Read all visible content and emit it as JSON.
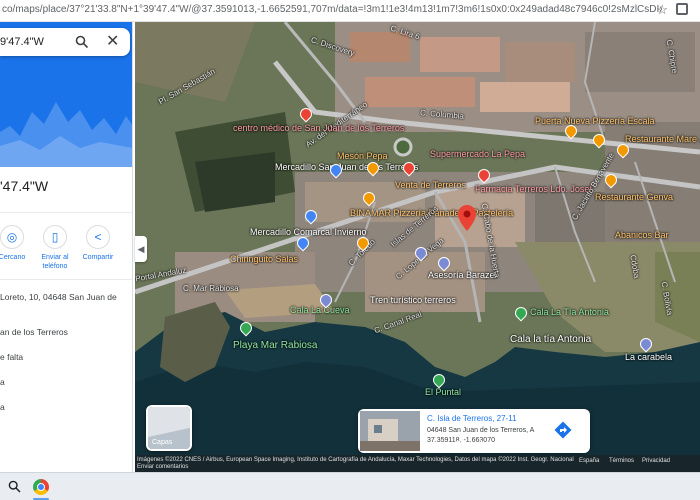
{
  "browser": {
    "url": "co/maps/place/37°21'33.8\"N+1°39'47.4\"W/@37.3591013,-1.6652591,707m/data=!3m1!1e3!4m13!1m7!3m6!1s0x0:0x249adad48c7946c0!2sMzlCsDIxJzMzLjgiTiAxwrAzOScNy40lc!3b1!8m2!3d37.359118!4d-1.6630"
  },
  "sidebar": {
    "search_value": "9'47.4\"W",
    "coordinate_title": "'47.4\"W",
    "actions": [
      {
        "label": "Cercano",
        "icon": "nearby-icon"
      },
      {
        "label": "Enviar al teléfono",
        "icon": "send-to-phone-icon"
      },
      {
        "label": "Compartir",
        "icon": "share-icon"
      }
    ],
    "info_lines": [
      "Loreto, 10, 04648 San Juan de",
      "an de los Terreros",
      "e falta",
      "a",
      "a"
    ]
  },
  "map": {
    "labels": [
      {
        "text": "C. Discovery",
        "kind": "street"
      },
      {
        "text": "C. Lira 6",
        "kind": "street"
      },
      {
        "text": "Pl. San Sebastián",
        "kind": "street"
      },
      {
        "text": "Av. del Mediterráneo",
        "kind": "street"
      },
      {
        "text": "C. Columbia",
        "kind": "street"
      },
      {
        "text": "centro médico de San Juan de los Terreros",
        "kind": "poi"
      },
      {
        "text": "Mesón Pepa",
        "kind": "food"
      },
      {
        "text": "Supermercado La Pepa",
        "kind": "poi"
      },
      {
        "text": "Puerta Nueva Pizzería Escala",
        "kind": "food"
      },
      {
        "text": "Restaurante Mare Juan de",
        "kind": "food"
      },
      {
        "text": "Mercadillo San Juan de los Terreros",
        "kind": "place"
      },
      {
        "text": "Venta de Terreros",
        "kind": "food"
      },
      {
        "text": "Farmacia Terreros Ldo. Josef",
        "kind": "poi"
      },
      {
        "text": "BINAMAR Pizzería Panadería Pastelería",
        "kind": "food"
      },
      {
        "text": "Restaurante Genva",
        "kind": "food"
      },
      {
        "text": "Mercadillo Comarcal Invierno",
        "kind": "place"
      },
      {
        "text": "Abanicos Bar",
        "kind": "food"
      },
      {
        "text": "Chiringuito Salas",
        "kind": "food"
      },
      {
        "text": "Asesoría Barazel",
        "kind": "place"
      },
      {
        "text": "C. Mar Rabiosa",
        "kind": "street"
      },
      {
        "text": "Tren turístico terreros",
        "kind": "place"
      },
      {
        "text": "Cala La Cueva",
        "kind": "park"
      },
      {
        "text": "Cala La Tía Antonia",
        "kind": "park"
      },
      {
        "text": "Cala la tía Antonia",
        "kind": "place"
      },
      {
        "text": "Playa Mar Rabiosa",
        "kind": "park"
      },
      {
        "text": "El Puntal",
        "kind": "park"
      },
      {
        "text": "La carabela",
        "kind": "place"
      },
      {
        "text": "C. Lope de Vega",
        "kind": "street"
      },
      {
        "text": "C. Cabo de la Huerta",
        "kind": "street"
      },
      {
        "text": "C. Canal Real",
        "kind": "street"
      },
      {
        "text": "C. Toledo",
        "kind": "street"
      },
      {
        "text": "Portal Andaluz",
        "kind": "street"
      },
      {
        "text": "C. Jacinto Benavente",
        "kind": "street"
      },
      {
        "text": "C. Chipre",
        "kind": "street"
      },
      {
        "text": "C. Bolivia",
        "kind": "street"
      },
      {
        "text": "Cdoba",
        "kind": "street"
      },
      {
        "text": "Islas de Terreros",
        "kind": "street"
      }
    ],
    "layers_label": "Capas",
    "google_logo": "Google"
  },
  "place_card": {
    "title": "C. Isla de Terreros, 27-11",
    "address": "04648 San Juan de los Terreros, A",
    "coords": "37.359118, -1.663070"
  },
  "attribution": {
    "line1": "Imágenes ©2022 CNES / Airbus, European Space Imaging, Instituto de Cartografía de Andalucía, Maxar Technologies, Datos del mapa ©2022 Inst. Geogr. Nacional",
    "line2": "Enviar comentarios",
    "links": [
      "España",
      "Términos",
      "Privacidad"
    ]
  },
  "colors": {
    "accent_blue": "#1a73e8",
    "pin_red": "#ea4335",
    "food_orange": "#f29900",
    "poi_pink": "#ff9fa6",
    "sea": "#163842"
  }
}
